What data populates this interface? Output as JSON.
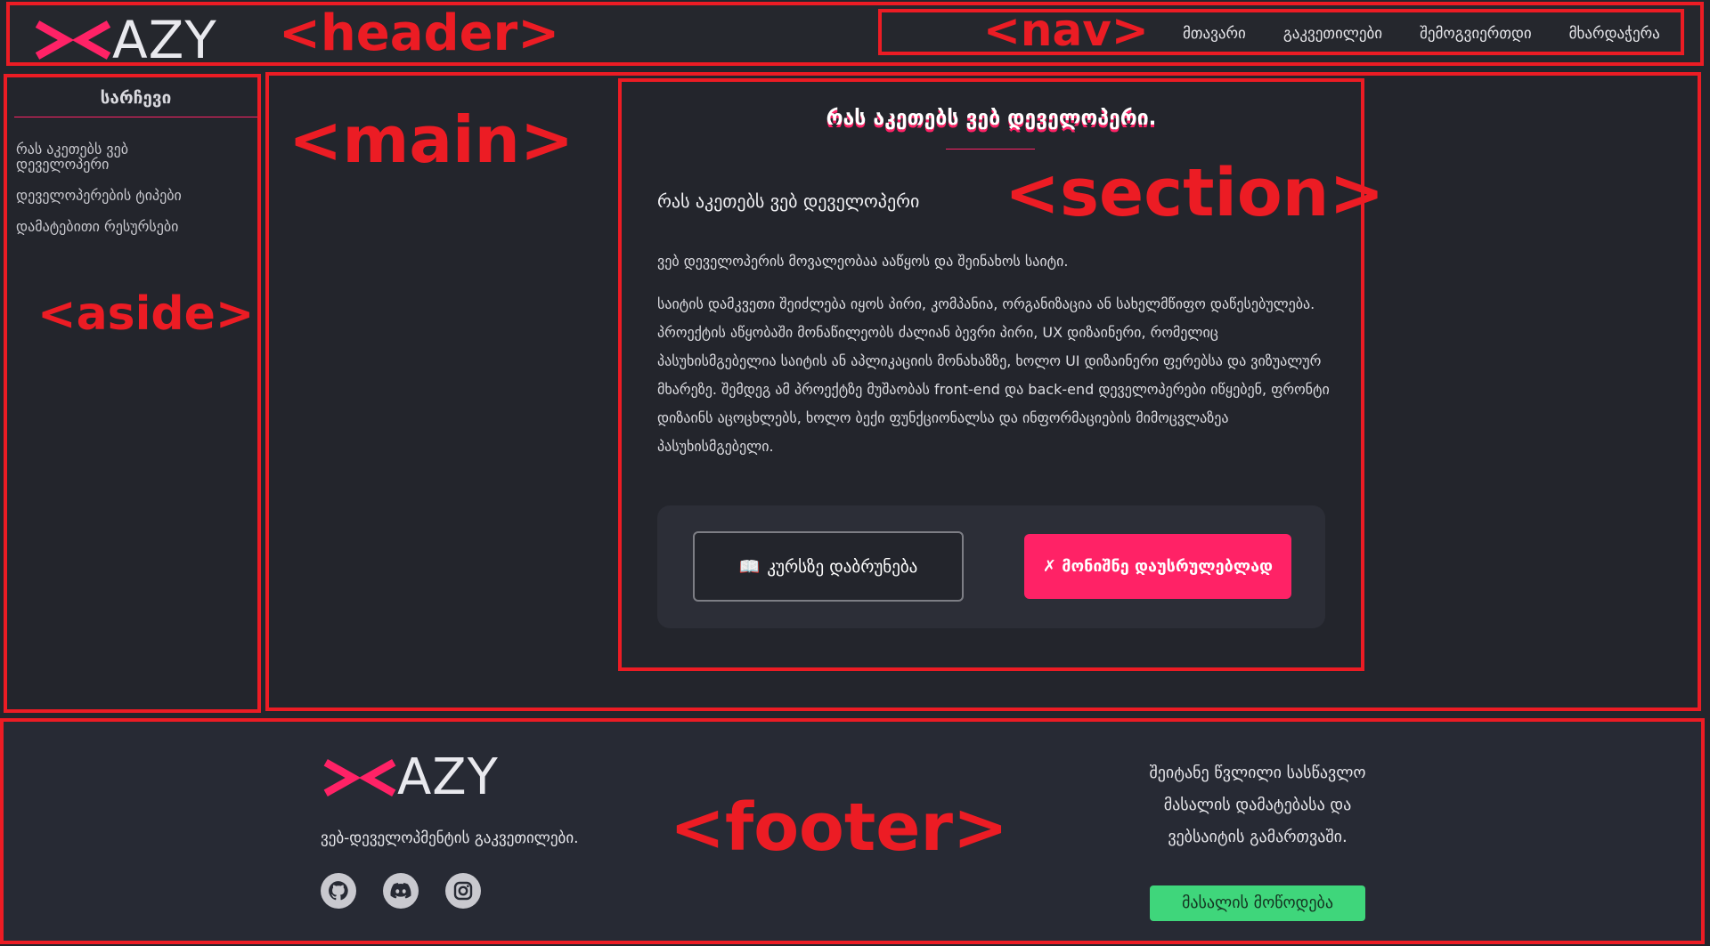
{
  "annotations": {
    "header": "<header>",
    "nav": "<nav>",
    "aside": "<aside>",
    "main": "<main>",
    "section": "<section>",
    "footer": "<footer>"
  },
  "brand": {
    "logo_text": "AZY",
    "accent": "#ff2266"
  },
  "nav": {
    "items": [
      {
        "label": "მთავარი"
      },
      {
        "label": "გაკვეთილები"
      },
      {
        "label": "შემოგვიერთდი"
      },
      {
        "label": "მხარდაჭერა"
      }
    ]
  },
  "aside": {
    "title": "სარჩევი",
    "links": [
      {
        "label": "რას აკეთებს ვებ დეველოპერი"
      },
      {
        "label": "დეველოპერების ტიპები"
      },
      {
        "label": "დამატებითი რესურსები"
      }
    ]
  },
  "section": {
    "title": "რას აკეთებს ვებ დეველოპერი.",
    "subtitle": "რას აკეთებს ვებ დეველოპერი",
    "paragraphs": [
      "ვებ დეველოპერის მოვალეობაა ააწყოს და შეინახოს საიტი.",
      "საიტის დამკვეთი შეიძლება იყოს პირი, კომპანია, ორგანიზაცია ან სახელმწიფო დაწესებულება. პროექტის აწყობაში მონაწილეობს ძალიან ბევრი პირი, UX დიზაინერი, რომელიც პასუხისმგებელია საიტის ან აპლიკაციის მონახაზზე, ხოლო UI დიზაინერი ფერებსა და ვიზუალურ მხარეზე. შემდეგ ამ პროექტზე მუშაობას front-end და back-end დეველოპერები იწყებენ, ფრონტი დიზაინს აცოცხლებს, ხოლო ბექი ფუნქციონალსა და ინფორმაციების მიმოცვლაზეა პასუხისმგებელი."
    ],
    "back_button": {
      "icon": "📖",
      "label": "კურსზე დაბრუნება"
    },
    "complete_button": {
      "label": "✗ მონიშნე დაუსრულებლად"
    }
  },
  "footer": {
    "logo_text": "AZY",
    "tagline": "ვებ-დეველოპმენტის გაკვეთილები.",
    "socials": [
      {
        "name": "github-icon"
      },
      {
        "name": "discord-icon"
      },
      {
        "name": "instagram-icon"
      }
    ],
    "message_lines": [
      "შეიტანე წვლილი სასწავლო",
      "მასალის დამატებასა და",
      "ვებსაიტის გამართვაში."
    ],
    "suggest_button": "მასალის მოწოდება"
  }
}
